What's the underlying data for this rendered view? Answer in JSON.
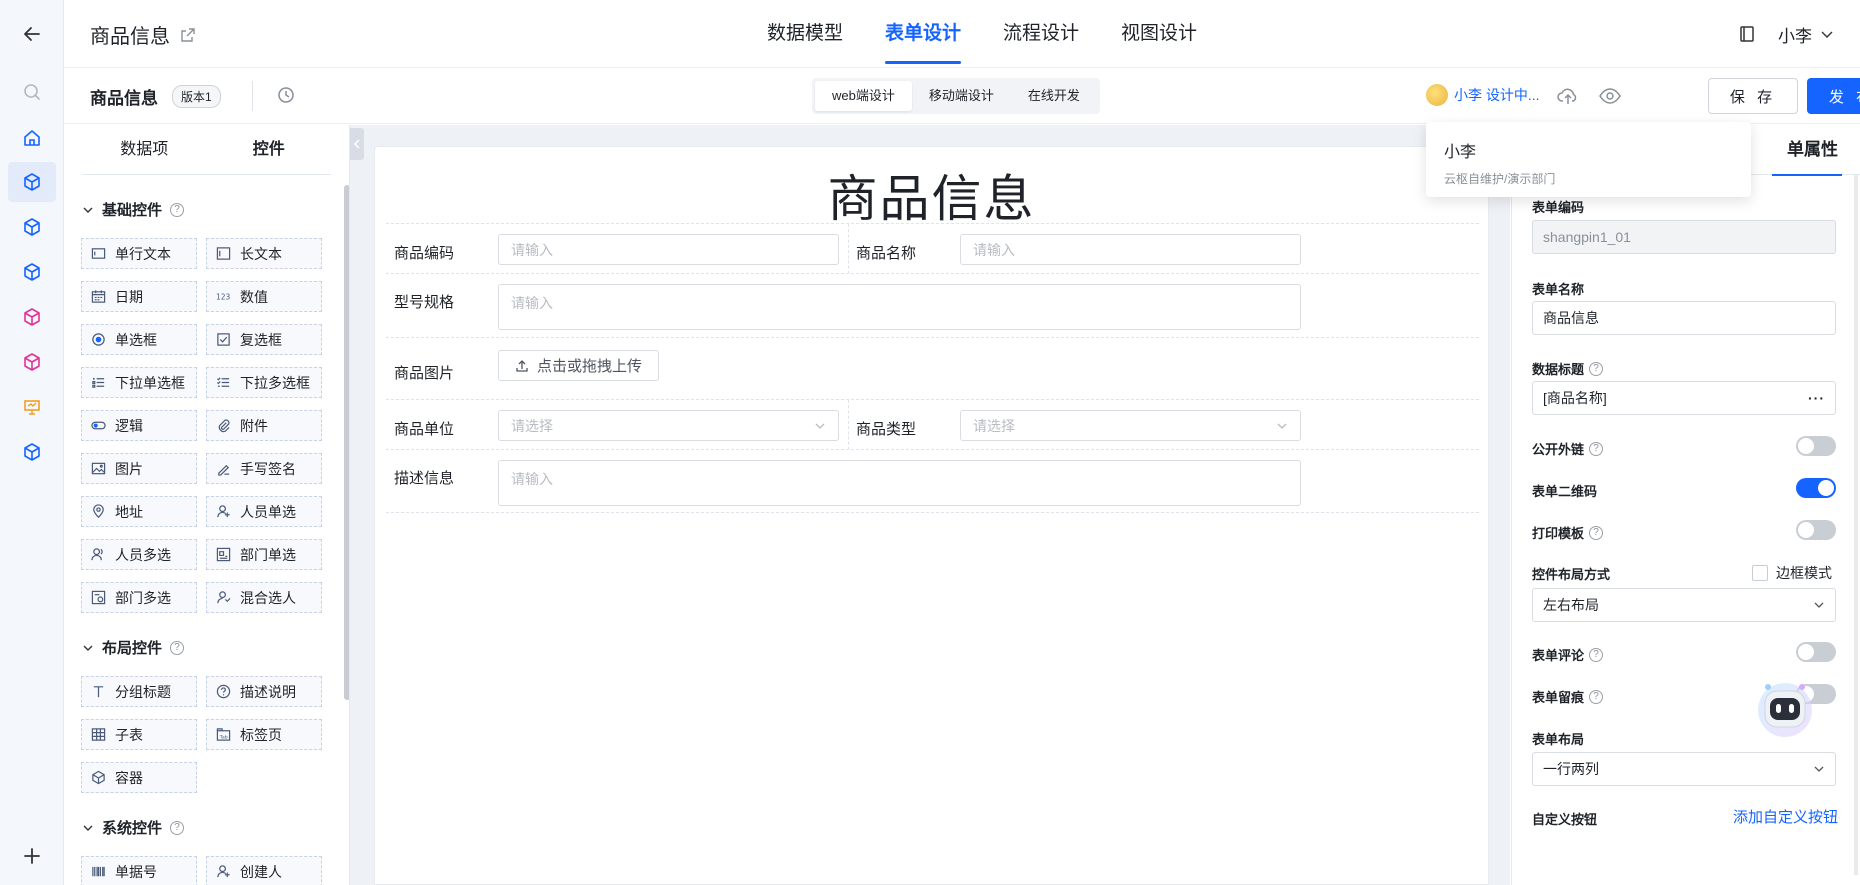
{
  "header": {
    "app_title": "商品信息",
    "tabs": [
      {
        "label": "数据模型",
        "active": false
      },
      {
        "label": "表单设计",
        "active": true
      },
      {
        "label": "流程设计",
        "active": false
      },
      {
        "label": "视图设计",
        "active": false
      }
    ],
    "user_name": "小李"
  },
  "toolbar": {
    "form_name": "商品信息",
    "version": "版本1",
    "modes": [
      {
        "label": "web端设计",
        "active": true
      },
      {
        "label": "移动端设计",
        "active": false
      },
      {
        "label": "在线开发",
        "active": false
      }
    ],
    "collab_text": "小李 设计中...",
    "save_label": "保 存",
    "publish_label": "发 布"
  },
  "popover": {
    "name": "小李",
    "dept": "云枢自维护/演示部门"
  },
  "left_panel": {
    "tabs": [
      {
        "label": "数据项",
        "active": false
      },
      {
        "label": "控件",
        "active": true
      }
    ],
    "sections": [
      {
        "title": "基础控件",
        "items": [
          {
            "label": "单行文本",
            "icon": "text-input-icon"
          },
          {
            "label": "长文本",
            "icon": "textarea-icon"
          },
          {
            "label": "日期",
            "icon": "calendar-icon"
          },
          {
            "label": "数值",
            "icon": "number-icon"
          },
          {
            "label": "单选框",
            "icon": "radio-icon"
          },
          {
            "label": "复选框",
            "icon": "checkbox-icon"
          },
          {
            "label": "下拉单选框",
            "icon": "dropdown-single-icon"
          },
          {
            "label": "下拉多选框",
            "icon": "dropdown-multi-icon"
          },
          {
            "label": "逻辑",
            "icon": "toggle-icon"
          },
          {
            "label": "附件",
            "icon": "attachment-icon"
          },
          {
            "label": "图片",
            "icon": "image-icon"
          },
          {
            "label": "手写签名",
            "icon": "signature-icon"
          },
          {
            "label": "地址",
            "icon": "location-icon"
          },
          {
            "label": "人员单选",
            "icon": "person-icon"
          },
          {
            "label": "人员多选",
            "icon": "people-icon"
          },
          {
            "label": "部门单选",
            "icon": "department-icon"
          },
          {
            "label": "部门多选",
            "icon": "departments-icon"
          },
          {
            "label": "混合选人",
            "icon": "mixed-person-icon"
          }
        ]
      },
      {
        "title": "布局控件",
        "items": [
          {
            "label": "分组标题",
            "icon": "group-title-icon"
          },
          {
            "label": "描述说明",
            "icon": "question-icon"
          },
          {
            "label": "子表",
            "icon": "table-icon"
          },
          {
            "label": "标签页",
            "icon": "tabs-icon"
          },
          {
            "label": "容器",
            "icon": "container-icon"
          }
        ]
      },
      {
        "title": "系统控件",
        "items": [
          {
            "label": "单据号",
            "icon": "barcode-icon"
          },
          {
            "label": "创建人",
            "icon": "person-icon"
          }
        ]
      }
    ]
  },
  "canvas": {
    "title": "商品信息",
    "fields": {
      "code_label": "商品编码",
      "name_label": "商品名称",
      "spec_label": "型号规格",
      "image_label": "商品图片",
      "unit_label": "商品单位",
      "type_label": "商品类型",
      "desc_label": "描述信息",
      "input_placeholder": "请输入",
      "select_placeholder": "请选择",
      "upload_label": "点击或拖拽上传"
    }
  },
  "right_panel": {
    "tab_label": "单属性",
    "form_code_label": "表单编码",
    "form_code_value": "shangpin1_01",
    "form_name_label": "表单名称",
    "form_name_value": "商品信息",
    "data_title_label": "数据标题",
    "data_title_value": "[商品名称]",
    "public_link_label": "公开外链",
    "public_link_on": false,
    "qrcode_label": "表单二维码",
    "qrcode_on": true,
    "print_label": "打印模板",
    "print_on": false,
    "layout_mode_label": "控件布局方式",
    "border_mode_label": "边框模式",
    "layout_mode_value": "左右布局",
    "comment_label": "表单评论",
    "comment_on": false,
    "trace_label": "表单留痕",
    "trace_on": false,
    "form_layout_label": "表单布局",
    "form_layout_value": "一行两列",
    "custom_button_label": "自定义按钮",
    "add_custom_button": "添加自定义按钮"
  },
  "colors": {
    "accent": "#1664ff",
    "rail_bg": "#f4f7fc",
    "canvas_bg": "#eef1f6"
  }
}
